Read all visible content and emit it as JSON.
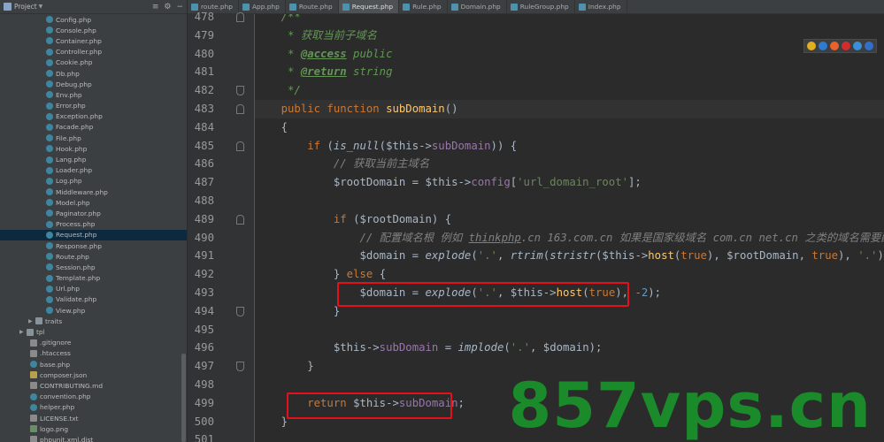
{
  "project_panel": {
    "title": "Project",
    "tools": [
      "≡",
      "⚙",
      "−"
    ],
    "tree": [
      {
        "label": "Config.php",
        "type": "php",
        "indent": 52
      },
      {
        "label": "Console.php",
        "type": "php",
        "indent": 52
      },
      {
        "label": "Container.php",
        "type": "php",
        "indent": 52
      },
      {
        "label": "Controller.php",
        "type": "php",
        "indent": 52
      },
      {
        "label": "Cookie.php",
        "type": "php",
        "indent": 52
      },
      {
        "label": "Db.php",
        "type": "php",
        "indent": 52
      },
      {
        "label": "Debug.php",
        "type": "php",
        "indent": 52
      },
      {
        "label": "Env.php",
        "type": "php",
        "indent": 52
      },
      {
        "label": "Error.php",
        "type": "php",
        "indent": 52
      },
      {
        "label": "Exception.php",
        "type": "php",
        "indent": 52
      },
      {
        "label": "Facade.php",
        "type": "php",
        "indent": 52
      },
      {
        "label": "File.php",
        "type": "php",
        "indent": 52
      },
      {
        "label": "Hook.php",
        "type": "php",
        "indent": 52
      },
      {
        "label": "Lang.php",
        "type": "php",
        "indent": 52
      },
      {
        "label": "Loader.php",
        "type": "php",
        "indent": 52
      },
      {
        "label": "Log.php",
        "type": "php",
        "indent": 52
      },
      {
        "label": "Middleware.php",
        "type": "php",
        "indent": 52
      },
      {
        "label": "Model.php",
        "type": "php",
        "indent": 52
      },
      {
        "label": "Paginator.php",
        "type": "php",
        "indent": 52
      },
      {
        "label": "Process.php",
        "type": "php",
        "indent": 52
      },
      {
        "label": "Request.php",
        "type": "php",
        "indent": 52,
        "selected": true
      },
      {
        "label": "Response.php",
        "type": "php",
        "indent": 52
      },
      {
        "label": "Route.php",
        "type": "php",
        "indent": 52
      },
      {
        "label": "Session.php",
        "type": "php",
        "indent": 52
      },
      {
        "label": "Template.php",
        "type": "php",
        "indent": 52
      },
      {
        "label": "Url.php",
        "type": "php",
        "indent": 52
      },
      {
        "label": "Validate.php",
        "type": "php",
        "indent": 52
      },
      {
        "label": "View.php",
        "type": "php",
        "indent": 52
      },
      {
        "label": "traits",
        "type": "folder",
        "indent": 32,
        "arrow": "▶"
      },
      {
        "label": "tpl",
        "type": "folder",
        "indent": 22,
        "arrow": "▶"
      },
      {
        "label": ".gitignore",
        "type": "file",
        "indent": 34
      },
      {
        "label": ".htaccess",
        "type": "file",
        "indent": 34
      },
      {
        "label": "base.php",
        "type": "php",
        "indent": 34
      },
      {
        "label": "composer.json",
        "type": "json",
        "indent": 34
      },
      {
        "label": "CONTRIBUTING.md",
        "type": "file",
        "indent": 34
      },
      {
        "label": "convention.php",
        "type": "php",
        "indent": 34
      },
      {
        "label": "helper.php",
        "type": "php",
        "indent": 34
      },
      {
        "label": "LICENSE.txt",
        "type": "file",
        "indent": 34
      },
      {
        "label": "logo.png",
        "type": "img",
        "indent": 34
      },
      {
        "label": "phpunit.xml.dist",
        "type": "file",
        "indent": 34
      }
    ]
  },
  "tabs": [
    {
      "label": "route.php"
    },
    {
      "label": "App.php"
    },
    {
      "label": "Route.php"
    },
    {
      "label": "Request.php",
      "active": true
    },
    {
      "label": "Rule.php"
    },
    {
      "label": "Domain.php"
    },
    {
      "label": "RuleGroup.php"
    },
    {
      "label": "Index.php"
    }
  ],
  "editor": {
    "current_line_number": "483",
    "lines": [
      {
        "n": "478",
        "tokens": [
          [
            "c-com",
            "    /**"
          ]
        ]
      },
      {
        "n": "479",
        "tokens": [
          [
            "c-com",
            "     * 获取当前子域名"
          ]
        ]
      },
      {
        "n": "480",
        "tokens": [
          [
            "c-com",
            "     * "
          ],
          [
            "c-tag",
            "@access"
          ],
          [
            "c-com",
            " public"
          ]
        ]
      },
      {
        "n": "481",
        "tokens": [
          [
            "c-com",
            "     * "
          ],
          [
            "c-tag",
            "@return"
          ],
          [
            "c-com",
            " string"
          ]
        ]
      },
      {
        "n": "482",
        "tokens": [
          [
            "c-com",
            "     */"
          ]
        ]
      },
      {
        "n": "483",
        "tokens": [
          [
            "c-kw",
            "    public function "
          ],
          [
            "c-fn",
            "subDomain"
          ],
          [
            "c-var",
            "()"
          ]
        ]
      },
      {
        "n": "484",
        "tokens": [
          [
            "c-var",
            "    {"
          ]
        ]
      },
      {
        "n": "485",
        "tokens": [
          [
            "c-kw",
            "        if "
          ],
          [
            "c-var",
            "("
          ],
          [
            "c-ifn",
            "is_null"
          ],
          [
            "c-var",
            "($this->"
          ],
          [
            "c-prop",
            "subDomain"
          ],
          [
            "c-var",
            ")) {"
          ]
        ]
      },
      {
        "n": "486",
        "tokens": [
          [
            "c-lcom",
            "            // 获取当前主域名"
          ]
        ]
      },
      {
        "n": "487",
        "tokens": [
          [
            "c-var",
            "            $rootDomain = $this->"
          ],
          [
            "c-prop",
            "config"
          ],
          [
            "c-var",
            "["
          ],
          [
            "c-str",
            "'url_domain_root'"
          ],
          [
            "c-var",
            "];"
          ]
        ]
      },
      {
        "n": "488",
        "tokens": [
          [
            "c-var",
            ""
          ]
        ]
      },
      {
        "n": "489",
        "tokens": [
          [
            "c-kw",
            "            if "
          ],
          [
            "c-var",
            "($rootDomain) {"
          ]
        ]
      },
      {
        "n": "490",
        "tokens": [
          [
            "c-lcom",
            "                // 配置域名根 例如 "
          ],
          [
            "c-lcom c-under",
            "thinkphp"
          ],
          [
            "c-lcom",
            ".cn 163.com.cn 如果是国家级域名 com.cn net.cn 之类的域名需要配置"
          ]
        ]
      },
      {
        "n": "491",
        "tokens": [
          [
            "c-var",
            "                $domain = "
          ],
          [
            "c-ifn",
            "explode"
          ],
          [
            "c-var",
            "("
          ],
          [
            "c-str",
            "'.'"
          ],
          [
            "c-var",
            ", "
          ],
          [
            "c-ifn",
            "rtrim"
          ],
          [
            "c-var",
            "("
          ],
          [
            "c-ifn",
            "stristr"
          ],
          [
            "c-var",
            "($this->"
          ],
          [
            "c-fn",
            "host"
          ],
          [
            "c-var",
            "("
          ],
          [
            "c-kw",
            "true"
          ],
          [
            "c-var",
            "), $rootDomain, "
          ],
          [
            "c-kw",
            "true"
          ],
          [
            "c-var",
            "), "
          ],
          [
            "c-str",
            "'.'"
          ],
          [
            "c-var",
            "));"
          ]
        ]
      },
      {
        "n": "492",
        "tokens": [
          [
            "c-var",
            "            } "
          ],
          [
            "c-kw",
            "else "
          ],
          [
            "c-var",
            "{"
          ]
        ]
      },
      {
        "n": "493",
        "tokens": [
          [
            "c-var",
            "                $domain = "
          ],
          [
            "c-ifn",
            "explode"
          ],
          [
            "c-var",
            "("
          ],
          [
            "c-str",
            "'.'"
          ],
          [
            "c-var",
            ", $this->"
          ],
          [
            "c-fn",
            "host"
          ],
          [
            "c-var",
            "("
          ],
          [
            "c-kw",
            "true"
          ],
          [
            "c-var",
            "), "
          ],
          [
            "c-num",
            "-2"
          ],
          [
            "c-var",
            ");"
          ]
        ]
      },
      {
        "n": "494",
        "tokens": [
          [
            "c-var",
            "            }"
          ]
        ]
      },
      {
        "n": "495",
        "tokens": [
          [
            "c-var",
            ""
          ]
        ]
      },
      {
        "n": "496",
        "tokens": [
          [
            "c-var",
            "            $this->"
          ],
          [
            "c-prop",
            "subDomain"
          ],
          [
            "c-var",
            " = "
          ],
          [
            "c-ifn",
            "implode"
          ],
          [
            "c-var",
            "("
          ],
          [
            "c-str",
            "'.'"
          ],
          [
            "c-var",
            ", $domain);"
          ]
        ]
      },
      {
        "n": "497",
        "tokens": [
          [
            "c-var",
            "        }"
          ]
        ]
      },
      {
        "n": "498",
        "tokens": [
          [
            "c-var",
            ""
          ]
        ]
      },
      {
        "n": "499",
        "tokens": [
          [
            "c-kw",
            "        return "
          ],
          [
            "c-var",
            "$this->"
          ],
          [
            "c-prop",
            "subDomain"
          ],
          [
            "c-var",
            ";"
          ]
        ]
      },
      {
        "n": "500",
        "tokens": [
          [
            "c-var",
            "    }"
          ]
        ]
      },
      {
        "n": "501",
        "tokens": [
          [
            "c-var",
            ""
          ]
        ]
      }
    ]
  },
  "browser_icons": [
    {
      "name": "chrome-icon",
      "color": "#e0b020"
    },
    {
      "name": "ie-icon",
      "color": "#2f7bd0"
    },
    {
      "name": "firefox-icon",
      "color": "#e8622a"
    },
    {
      "name": "opera-icon",
      "color": "#d32c2c"
    },
    {
      "name": "safari-icon",
      "color": "#3a8fd9"
    },
    {
      "name": "edge-icon",
      "color": "#3070c8"
    }
  ],
  "watermark": "857vps.cn"
}
